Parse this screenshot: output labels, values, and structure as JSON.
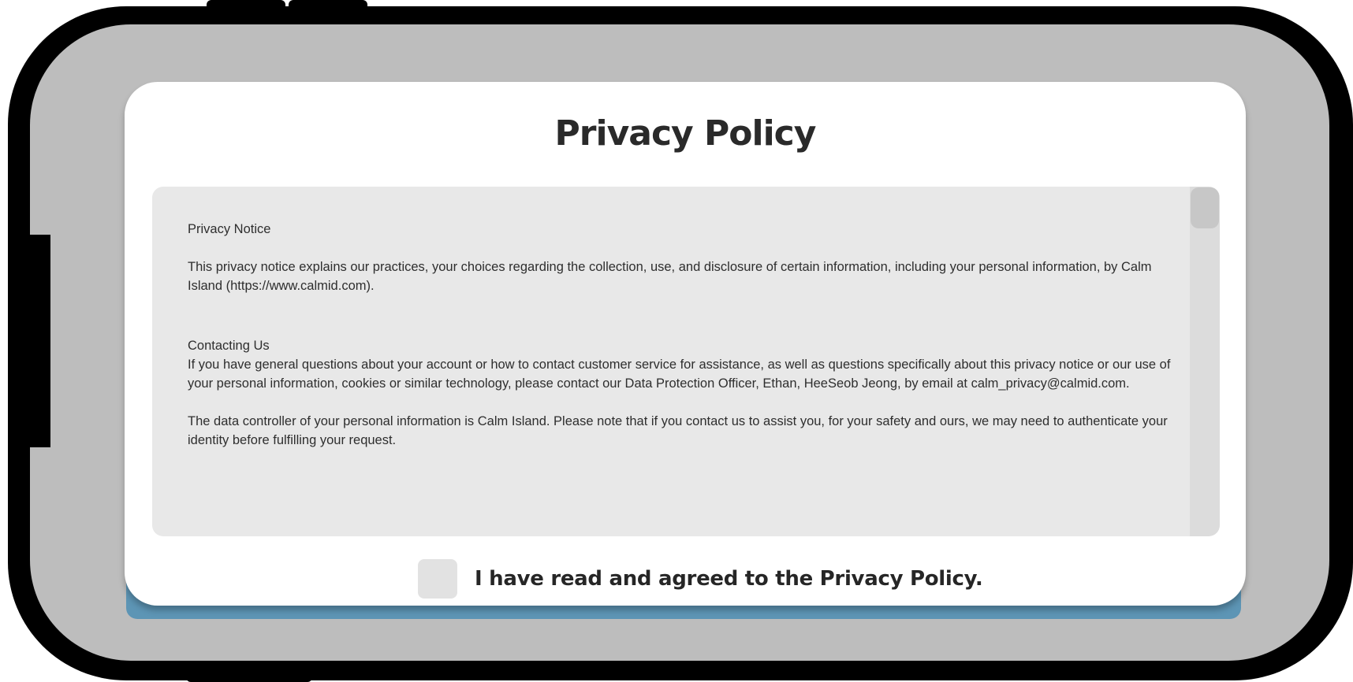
{
  "dialog": {
    "title": "Privacy Policy"
  },
  "policy": {
    "heading": "Privacy Notice",
    "intro": "This privacy notice explains our practices, your choices regarding the collection, use, and disclosure of certain information, including your personal information, by Calm Island (https://www.calmid.com).",
    "contact_heading": "Contacting Us",
    "contact_body": "If you have general questions about your account or how to contact customer service for assistance, as well as questions specifically about this privacy notice or our use of your personal information, cookies or similar technology, please contact our Data Protection Officer, Ethan, HeeSeob Jeong, by email at calm_privacy@calmid.com.",
    "controller_body": "The data controller of your personal information is Calm Island. Please note that if you contact us to assist you, for your safety and ours, we may need to authenticate your identity before fulfilling your request."
  },
  "agreement": {
    "label": "I have read and agreed to the Privacy Policy.",
    "checked": false
  },
  "colors": {
    "screen_background": "#bdbdbd",
    "dialog_background": "#ffffff",
    "policy_box_background": "#e8e8e8",
    "button_accent": "#5d95b5",
    "phone_frame": "#000000"
  },
  "icons": {
    "checkbox": "checkbox-unchecked-icon"
  }
}
